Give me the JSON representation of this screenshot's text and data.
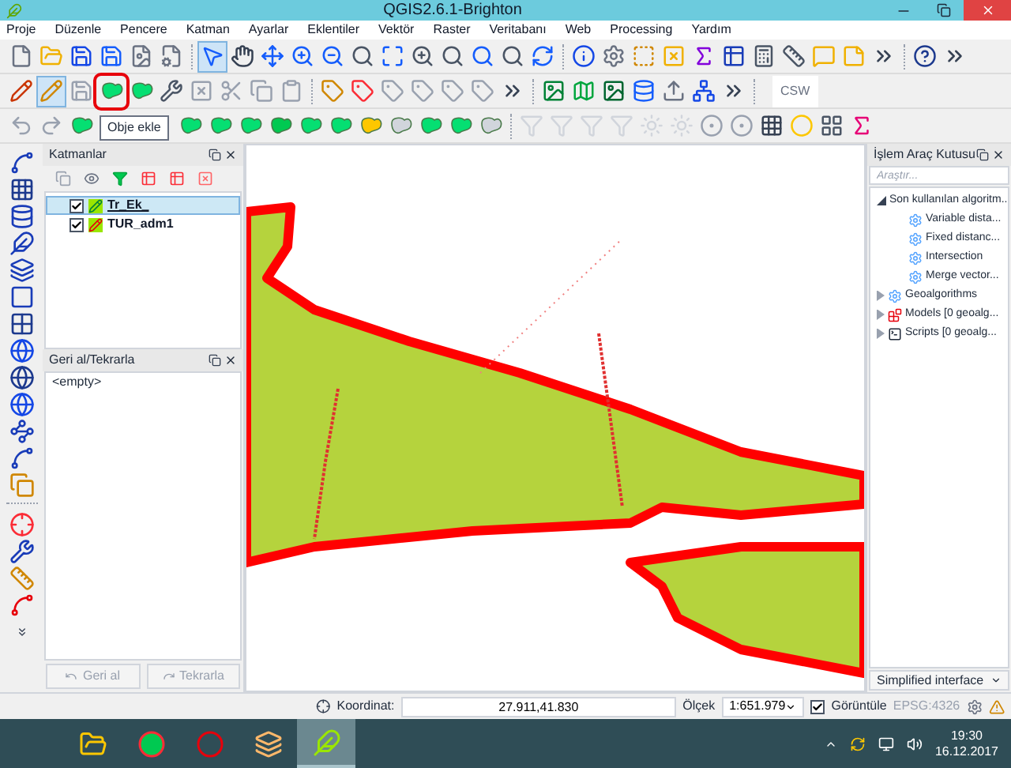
{
  "window": {
    "title": "QGIS2.6.1-Brighton"
  },
  "menu": [
    "Proje",
    "Düzenle",
    "Pencere",
    "Katman",
    "Ayarlar",
    "Eklentiler",
    "Vektör",
    "Raster",
    "Veritabanı",
    "Web",
    "Processing",
    "Yardım"
  ],
  "toolbars": [
    {
      "items": [
        {
          "selected": false
        },
        {
          "selected": false
        },
        {
          "selected": false
        },
        {
          "selected": false
        },
        {
          "selected": false
        },
        {
          "selected": false
        },
        {
          "selected": true
        },
        {
          "selected": false
        },
        {
          "selected": false
        },
        {
          "selected": false
        },
        {
          "selected": false
        },
        {
          "selected": false
        },
        {
          "selected": false
        },
        {
          "selected": false
        },
        {
          "selected": false
        },
        {
          "selected": false
        },
        {
          "selected": false
        },
        {
          "selected": false
        },
        {
          "selected": false
        },
        {
          "selected": false
        },
        {
          "selected": false
        },
        {
          "selected": false
        },
        {
          "selected": false
        },
        {
          "selected": false
        },
        {
          "selected": false
        },
        {
          "selected": false
        },
        {
          "selected": false
        },
        {
          "selected": false
        },
        {
          "selected": false
        },
        {
          "selected": false
        },
        {
          "selected": false
        }
      ]
    },
    {
      "items": [
        {
          "selected": false
        },
        {
          "selected": true
        },
        {
          "selected": false
        },
        {
          "selected": false,
          "highlighted": true,
          "tooltip": "Obje ekle"
        },
        {
          "selected": false
        },
        {
          "selected": false
        },
        {
          "selected": false
        },
        {
          "selected": false
        },
        {
          "selected": false
        },
        {
          "selected": false
        },
        {
          "selected": false
        },
        {
          "selected": false
        },
        {
          "selected": false
        },
        {
          "selected": false
        },
        {
          "selected": false
        },
        {
          "selected": false
        },
        {
          "selected": false
        },
        {
          "selected": false
        },
        {
          "selected": false
        },
        {
          "selected": false
        },
        {
          "selected": false
        },
        {
          "selected": false
        },
        {
          "selected": false
        },
        {
          "selected": false
        },
        {
          "selected": false,
          "label": "CSW"
        }
      ]
    },
    {
      "items": [
        {
          "selected": false
        },
        {
          "selected": false
        },
        {
          "selected": false
        },
        {
          "selected": false
        },
        {
          "selected": false
        },
        {
          "selected": false
        },
        {
          "selected": false
        },
        {
          "selected": false
        },
        {
          "selected": false
        },
        {
          "selected": false
        },
        {
          "selected": false
        },
        {
          "selected": false
        },
        {
          "selected": false
        },
        {
          "selected": false
        },
        {
          "selected": false
        },
        {
          "selected": false
        },
        {
          "selected": false
        },
        {
          "selected": false
        },
        {
          "selected": false
        },
        {
          "selected": false
        },
        {
          "selected": false
        },
        {
          "selected": false
        },
        {
          "selected": false
        },
        {
          "selected": false
        },
        {
          "selected": false
        },
        {
          "selected": false
        }
      ]
    }
  ],
  "layers_panel": {
    "title": "Katmanlar",
    "layers": [
      {
        "name": "Tr_Ek_",
        "checked": true,
        "selected": true
      },
      {
        "name": "TUR_adm1",
        "checked": true,
        "selected": false
      }
    ]
  },
  "undo_panel": {
    "title": "Geri al/Tekrarla",
    "entries": [
      "<empty>"
    ],
    "buttons": [
      {
        "label": "Geri al",
        "disabled": true
      },
      {
        "label": "Tekrarla",
        "disabled": true
      }
    ]
  },
  "toolbox": {
    "title": "İşlem Araç Kutusu",
    "search": {
      "placeholder": "Araştır..."
    },
    "tree": [
      {
        "label": "Son kullanılan algoritm...",
        "expanded": true,
        "children": [
          {
            "label": "Variable dista..."
          },
          {
            "label": "Fixed distanc..."
          },
          {
            "label": "Intersection"
          },
          {
            "label": "Merge vector..."
          }
        ]
      },
      {
        "label": "Geoalgorithms",
        "expanded": false
      },
      {
        "label": "Models [0 geoalg...",
        "expanded": false
      },
      {
        "label": "Scripts [0 geoalg...",
        "expanded": false
      }
    ],
    "mode": "Simplified interface"
  },
  "status_bar": {
    "coordinate_label": "Koordinat:",
    "coordinate": "27.911,41.830",
    "scale_label": "Ölçek",
    "scale": "1:651.979",
    "render": {
      "label": "Görüntüle",
      "checked": true
    },
    "crs": "EPSG:4326"
  },
  "taskbar": {
    "apps": [
      {
        "selected": false
      },
      {
        "selected": false
      },
      {
        "selected": false
      },
      {
        "selected": false
      },
      {
        "selected": true
      }
    ],
    "time": "19:30",
    "date": "16.12.2017"
  }
}
